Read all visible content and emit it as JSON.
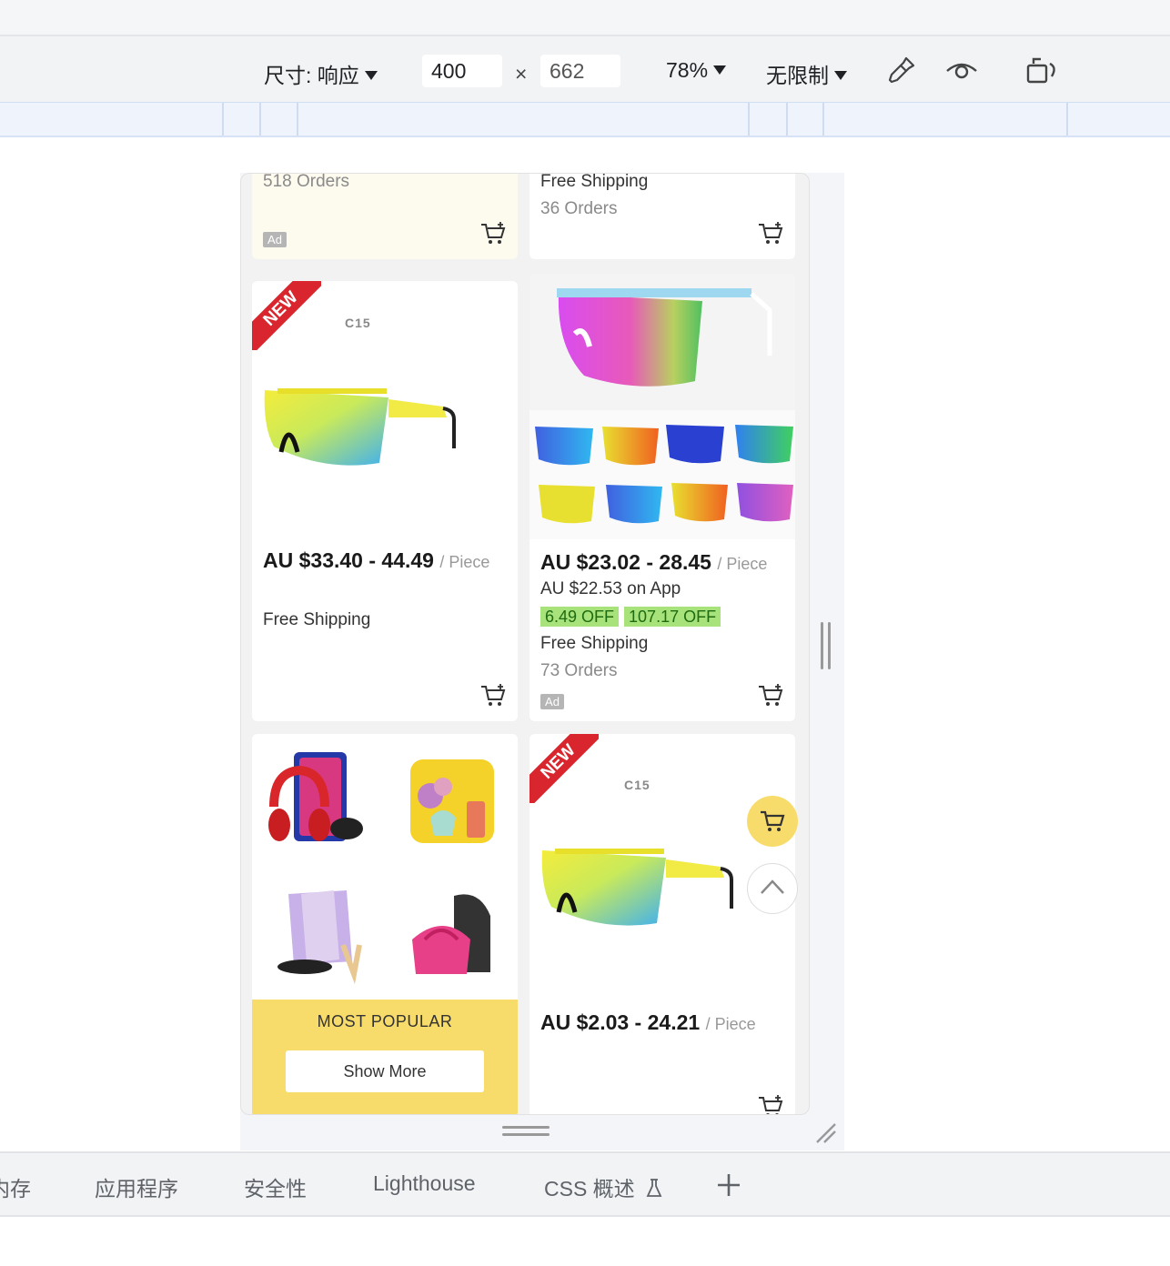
{
  "toolbar": {
    "dimensions_label": "尺寸: 响应",
    "width_value": "400",
    "times_sign": "×",
    "height_value": "662",
    "zoom": "78%",
    "throttle": "无限制"
  },
  "products": {
    "top_left": {
      "orders": "518 Orders",
      "ad": "Ad"
    },
    "top_right": {
      "shipping": "Free Shipping",
      "orders": "36 Orders"
    },
    "item1": {
      "badge": "NEW",
      "model": "C15",
      "price": "AU $33.40 - 44.49",
      "unit": "/ Piece",
      "shipping": "Free Shipping"
    },
    "item2": {
      "price": "AU $23.02 - 28.45",
      "unit": "/ Piece",
      "app_price": "AU $22.53 on App",
      "discounts": [
        "6.49 OFF",
        "107.17 OFF"
      ],
      "shipping": "Free Shipping",
      "orders": "73 Orders",
      "ad": "Ad"
    },
    "popular": {
      "label": "MOST POPULAR",
      "button": "Show More"
    },
    "item3": {
      "badge": "NEW",
      "model": "C15",
      "price": "AU $2.03 - 24.21",
      "unit": "/ Piece"
    }
  },
  "bottom_tabs": [
    "内存",
    "应用程序",
    "安全性",
    "Lighthouse",
    "CSS 概述"
  ],
  "colors": {
    "accent_yellow": "#f8dc6b",
    "new_badge": "#d9262e",
    "discount_green": "#a8e27a",
    "ad_card_bg": "#fdfaee"
  }
}
